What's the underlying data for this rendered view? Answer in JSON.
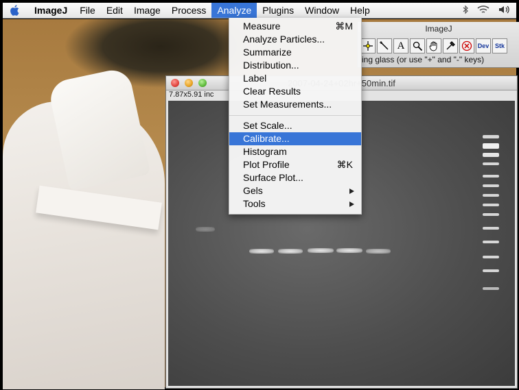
{
  "menubar": {
    "app_name": "ImageJ",
    "items": [
      "File",
      "Edit",
      "Image",
      "Process",
      "Analyze",
      "Plugins",
      "Window",
      "Help"
    ]
  },
  "analyze_menu": {
    "items": [
      {
        "label": "Measure",
        "shortcut": "⌘M"
      },
      {
        "label": "Analyze Particles..."
      },
      {
        "label": "Summarize"
      },
      {
        "label": "Distribution..."
      },
      {
        "label": "Label"
      },
      {
        "label": "Clear Results"
      },
      {
        "label": "Set Measurements..."
      },
      {
        "label": "Set Scale..."
      },
      {
        "label": "Calibrate...",
        "highlighted": true
      },
      {
        "label": "Histogram"
      },
      {
        "label": "Plot Profile",
        "shortcut": "⌘K"
      },
      {
        "label": "Surface Plot..."
      },
      {
        "label": "Gels",
        "submenu": true
      },
      {
        "label": "Tools",
        "submenu": true
      }
    ]
  },
  "toolbar_window": {
    "title": "ImageJ",
    "tools": [
      "crosshair-icon",
      "wand-icon",
      "text-tool",
      "magnifier-icon",
      "hand-icon",
      "dropper-icon",
      "close-icon",
      "dev-tool",
      "stk-tool"
    ],
    "tool_labels": {
      "text": "A",
      "dev": "Dev",
      "stk": "Stk"
    },
    "hint": "ing glass (or use \"+\" and \"-\" keys)"
  },
  "image_window": {
    "title": "2007-04-24+02hr+50min.tif",
    "info": "7.87x5.91 inc"
  },
  "colors": {
    "menu_highlight": "#3875d7",
    "menubar_bg": "#f0f0f0",
    "close_button": "#e0443e",
    "minimize_button": "#e8a323",
    "zoom_button": "#5fbb3c"
  }
}
